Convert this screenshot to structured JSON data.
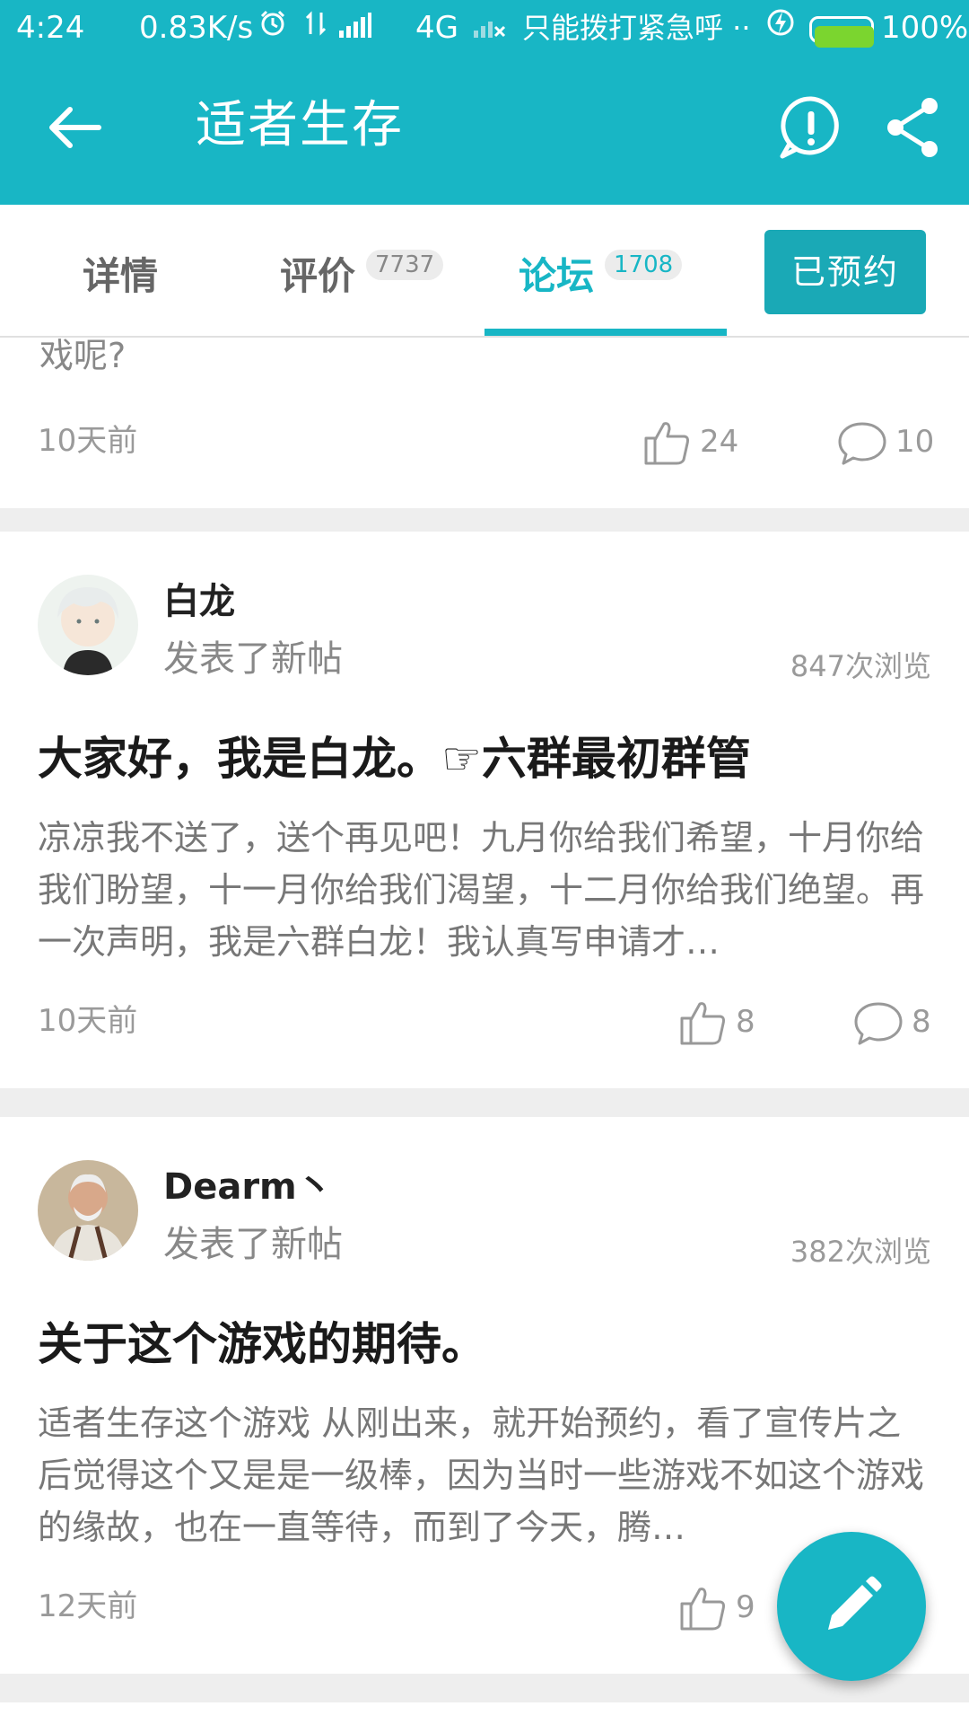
{
  "status_bar": {
    "time": "4:24",
    "speed": "0.83K/s",
    "network": "4G",
    "carrier": "只能拨打紧急呼 ··",
    "battery": "100%"
  },
  "app_bar": {
    "title": "适者生存"
  },
  "tabs": [
    {
      "label": "详情"
    },
    {
      "label": "评价",
      "badge": "7737"
    },
    {
      "label": "论坛",
      "badge": "1708",
      "active": true
    }
  ],
  "reserve_button": "已预约",
  "posts": [
    {
      "snippet_tail": "戏呢?",
      "time": "10天前",
      "likes": "24",
      "comments": "10"
    },
    {
      "username": "白龙",
      "action": "发表了新帖",
      "views": "847次浏览",
      "title": "大家好，我是白龙。☞六群最初群管",
      "body": "凉凉我不送了，送个再见吧！九月你给我们希望，十月你给我们盼望，十一月你给我们渴望，十二月你给我们绝望。再一次声明，我是六群白龙！我认真写申请才…",
      "time": "10天前",
      "likes": "8",
      "comments": "8"
    },
    {
      "username": "Dearm丶",
      "action": "发表了新帖",
      "views": "382次浏览",
      "title": "关于这个游戏的期待。",
      "body": "适者生存这个游戏 从刚出来，就开始预约，看了宣传片之后觉得这个又是是一级棒，因为当时一些游戏不如这个游戏的缘故，也在一直等待，而到了今天，腾…",
      "time": "12天前",
      "likes": "9"
    }
  ],
  "colors": {
    "primary": "#18b6c5",
    "reserve": "#1aa9b6"
  },
  "icons": [
    "back-arrow-icon",
    "report-icon",
    "share-icon",
    "thumbs-up-icon",
    "comment-icon",
    "edit-pencil-icon"
  ]
}
